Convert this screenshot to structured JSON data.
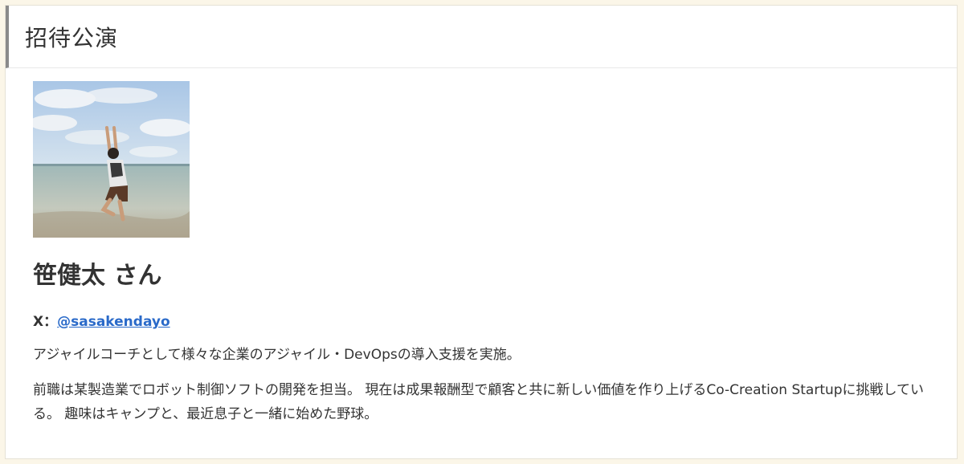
{
  "section": {
    "title": "招待公演"
  },
  "speaker": {
    "name": "笹健太 さん",
    "x_label": "X：",
    "x_handle": "@sasakendayo",
    "bio_1": "アジャイルコーチとして様々な企業のアジャイル・DevOpsの導入支援を実施。",
    "bio_2": "前職は某製造業でロボット制御ソフトの開発を担当。 現在は成果報酬型で顧客と共に新しい価値を作り上げるCo-Creation Startupに挑戦している。 趣味はキャンプと、最近息子と一緒に始めた野球。"
  }
}
